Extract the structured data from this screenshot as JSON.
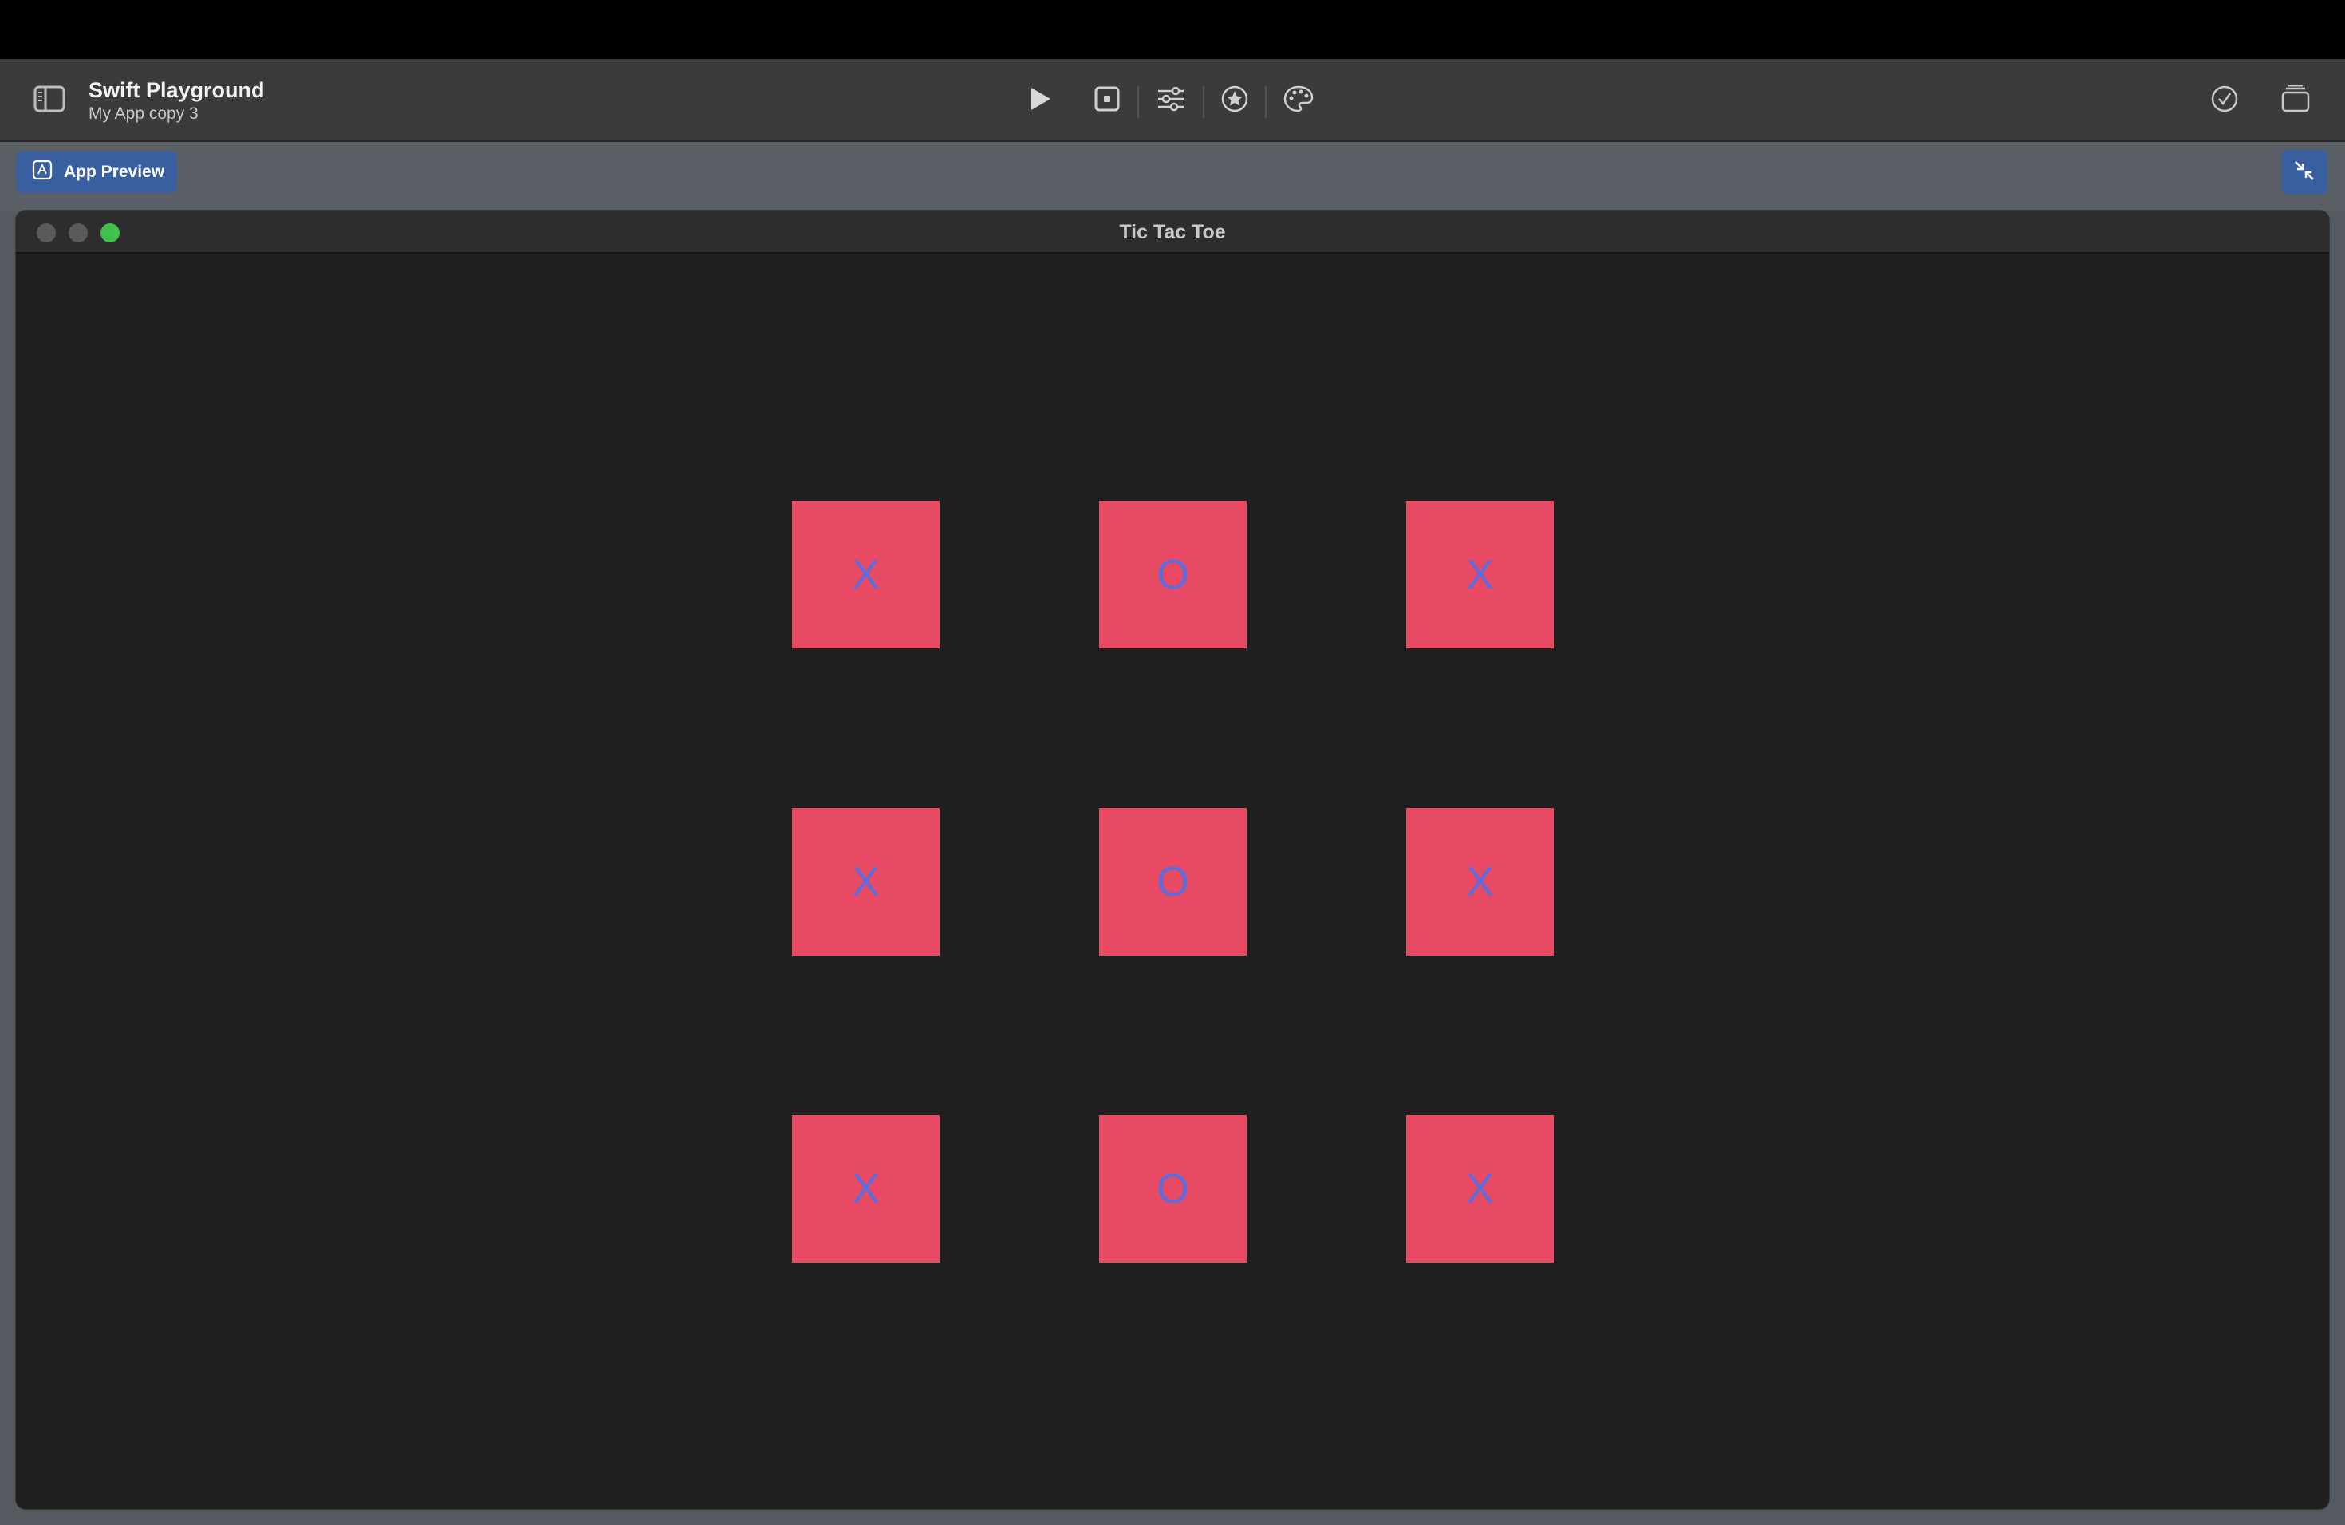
{
  "toolbar": {
    "app_title": "Swift Playground",
    "app_subtitle": "My App copy 3",
    "icons": [
      "sidebar-icon",
      "play-icon",
      "stop-icon",
      "sliders-icon",
      "star-circle-icon",
      "palette-icon",
      "checkmark-circle-icon",
      "stack-icon"
    ]
  },
  "subbar": {
    "preview_label": "App Preview",
    "icons": [
      "app-preview-icon",
      "collapse-icon"
    ]
  },
  "window": {
    "title": "Tic Tac Toe",
    "traffic_colors": {
      "close": "#5a5a5a",
      "minimize": "#5a5a5a",
      "zoom": "#3fc24b"
    }
  },
  "board": {
    "cells": [
      "X",
      "O",
      "X",
      "X",
      "O",
      "X",
      "X",
      "O",
      "X"
    ]
  },
  "colors": {
    "cell_background": "#e84a63",
    "cell_text": "#5a6ee0",
    "accent_button": "#3a5fa0"
  }
}
